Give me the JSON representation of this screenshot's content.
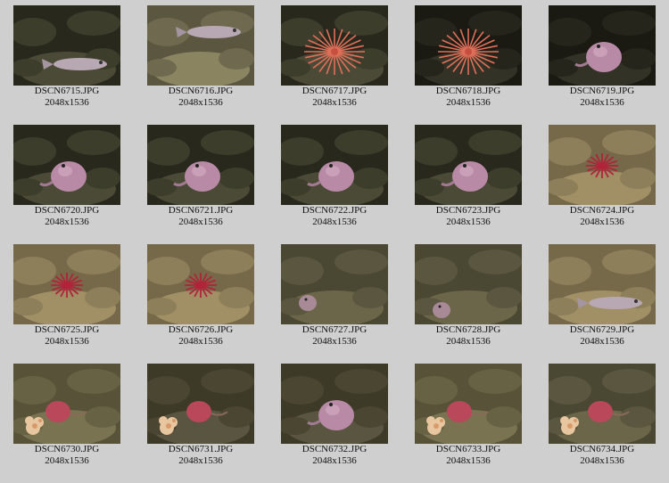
{
  "gallery": {
    "items": [
      {
        "filename": "DSCN6715.JPG",
        "dimensions": "2048x1536",
        "subject": "fish",
        "scene": "dark-rock"
      },
      {
        "filename": "DSCN6716.JPG",
        "dimensions": "2048x1536",
        "subject": "fish",
        "scene": "rock"
      },
      {
        "filename": "DSCN6717.JPG",
        "dimensions": "2048x1536",
        "subject": "feather-star",
        "scene": "dark-rock"
      },
      {
        "filename": "DSCN6718.JPG",
        "dimensions": "2048x1536",
        "subject": "feather-star",
        "scene": "dark"
      },
      {
        "filename": "DSCN6719.JPG",
        "dimensions": "2048x1536",
        "subject": "octopus",
        "scene": "dark"
      },
      {
        "filename": "DSCN6720.JPG",
        "dimensions": "2048x1536",
        "subject": "octopus",
        "scene": "dark-rock"
      },
      {
        "filename": "DSCN6721.JPG",
        "dimensions": "2048x1536",
        "subject": "octopus",
        "scene": "dark-rock"
      },
      {
        "filename": "DSCN6722.JPG",
        "dimensions": "2048x1536",
        "subject": "octopus",
        "scene": "dark-rock"
      },
      {
        "filename": "DSCN6723.JPG",
        "dimensions": "2048x1536",
        "subject": "octopus",
        "scene": "dark-rock"
      },
      {
        "filename": "DSCN6724.JPG",
        "dimensions": "2048x1536",
        "subject": "starfish",
        "scene": "sand-rock"
      },
      {
        "filename": "DSCN6725.JPG",
        "dimensions": "2048x1536",
        "subject": "starfish",
        "scene": "sand-rock"
      },
      {
        "filename": "DSCN6726.JPG",
        "dimensions": "2048x1536",
        "subject": "starfish",
        "scene": "sand-rock"
      },
      {
        "filename": "DSCN6727.JPG",
        "dimensions": "2048x1536",
        "subject": "small-octopus",
        "scene": "olive-rock"
      },
      {
        "filename": "DSCN6728.JPG",
        "dimensions": "2048x1536",
        "subject": "small-octopus",
        "scene": "olive-rock"
      },
      {
        "filename": "DSCN6729.JPG",
        "dimensions": "2048x1536",
        "subject": "fish",
        "scene": "sand-rock"
      },
      {
        "filename": "DSCN6730.JPG",
        "dimensions": "2048x1536",
        "subject": "octopus-coral",
        "scene": "olive"
      },
      {
        "filename": "DSCN6731.JPG",
        "dimensions": "2048x1536",
        "subject": "octopus-coral",
        "scene": "olive-dark"
      },
      {
        "filename": "DSCN6732.JPG",
        "dimensions": "2048x1536",
        "subject": "octopus",
        "scene": "olive-dark"
      },
      {
        "filename": "DSCN6733.JPG",
        "dimensions": "2048x1536",
        "subject": "octopus-coral",
        "scene": "olive"
      },
      {
        "filename": "DSCN6734.JPG",
        "dimensions": "2048x1536",
        "subject": "octopus-coral",
        "scene": "olive-rock"
      }
    ]
  },
  "colors": {
    "page_background": "#cfcfcf",
    "caption_text": "#111111"
  }
}
